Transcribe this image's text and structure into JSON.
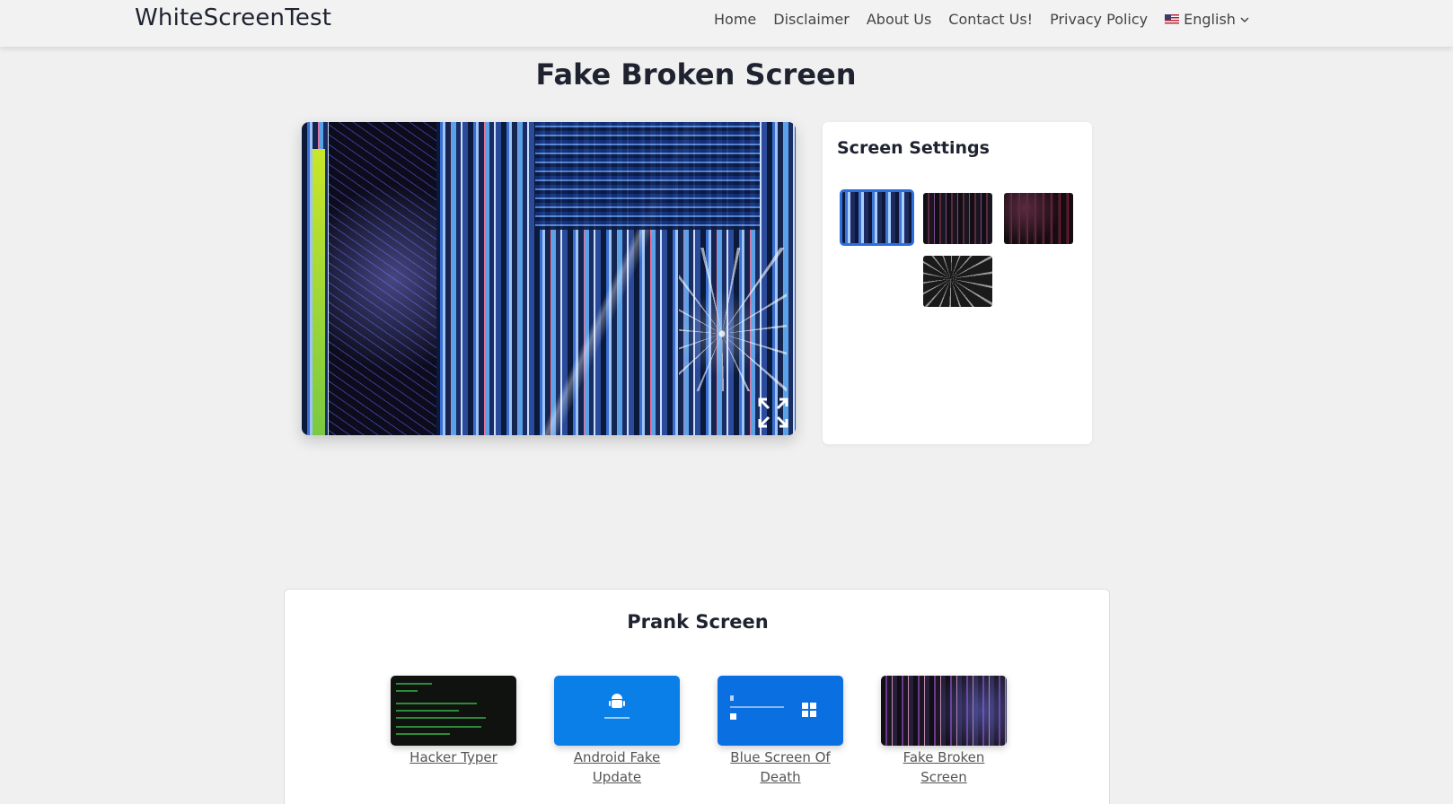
{
  "header": {
    "brand": "WhiteScreenTest",
    "nav": [
      "Home",
      "Disclaimer",
      "About Us",
      "Contact Us!",
      "Privacy Policy"
    ],
    "language": "English"
  },
  "page": {
    "title": "Fake Broken Screen"
  },
  "settings": {
    "title": "Screen Settings",
    "selected_index": 0
  },
  "prank": {
    "title": "Prank Screen",
    "items": [
      {
        "label": "Hacker Typer"
      },
      {
        "label": "Android Fake Update"
      },
      {
        "label": "Blue Screen Of Death"
      },
      {
        "label": "Fake Broken Screen"
      }
    ]
  },
  "colors": {
    "accent": "#2a6fdc",
    "android_blue": "#0b7fe8",
    "bsod_blue": "#0a6fe0"
  }
}
